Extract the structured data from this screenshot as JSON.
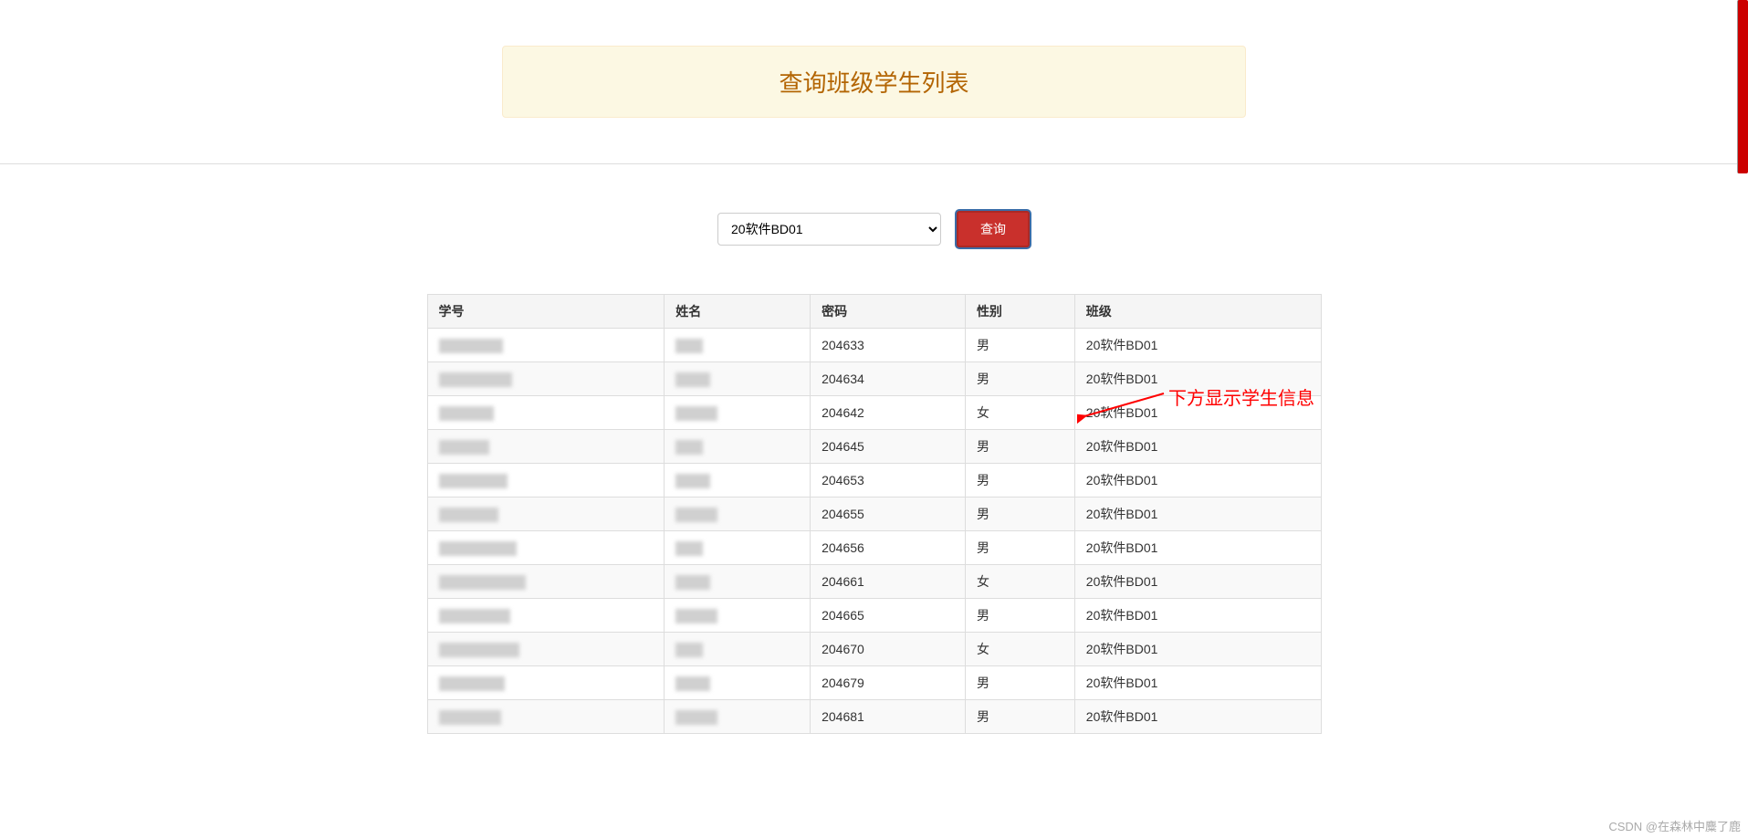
{
  "header": {
    "title": "查询班级学生列表"
  },
  "search": {
    "selected_class": "20软件BD01",
    "query_button": "查询"
  },
  "table": {
    "headers": {
      "id": "学号",
      "name": "姓名",
      "pwd": "密码",
      "gender": "性别",
      "class": "班级"
    },
    "rows": [
      {
        "pwd": "204633",
        "gender": "男",
        "class": "20软件BD01"
      },
      {
        "pwd": "204634",
        "gender": "男",
        "class": "20软件BD01"
      },
      {
        "pwd": "204642",
        "gender": "女",
        "class": "20软件BD01"
      },
      {
        "pwd": "204645",
        "gender": "男",
        "class": "20软件BD01"
      },
      {
        "pwd": "204653",
        "gender": "男",
        "class": "20软件BD01"
      },
      {
        "pwd": "204655",
        "gender": "男",
        "class": "20软件BD01"
      },
      {
        "pwd": "204656",
        "gender": "男",
        "class": "20软件BD01"
      },
      {
        "pwd": "204661",
        "gender": "女",
        "class": "20软件BD01"
      },
      {
        "pwd": "204665",
        "gender": "男",
        "class": "20软件BD01"
      },
      {
        "pwd": "204670",
        "gender": "女",
        "class": "20软件BD01"
      },
      {
        "pwd": "204679",
        "gender": "男",
        "class": "20软件BD01"
      },
      {
        "pwd": "204681",
        "gender": "男",
        "class": "20软件BD01"
      }
    ]
  },
  "annotation": {
    "text": "下方显示学生信息"
  },
  "watermark": {
    "text": "CSDN @在森林中麋了鹿"
  }
}
